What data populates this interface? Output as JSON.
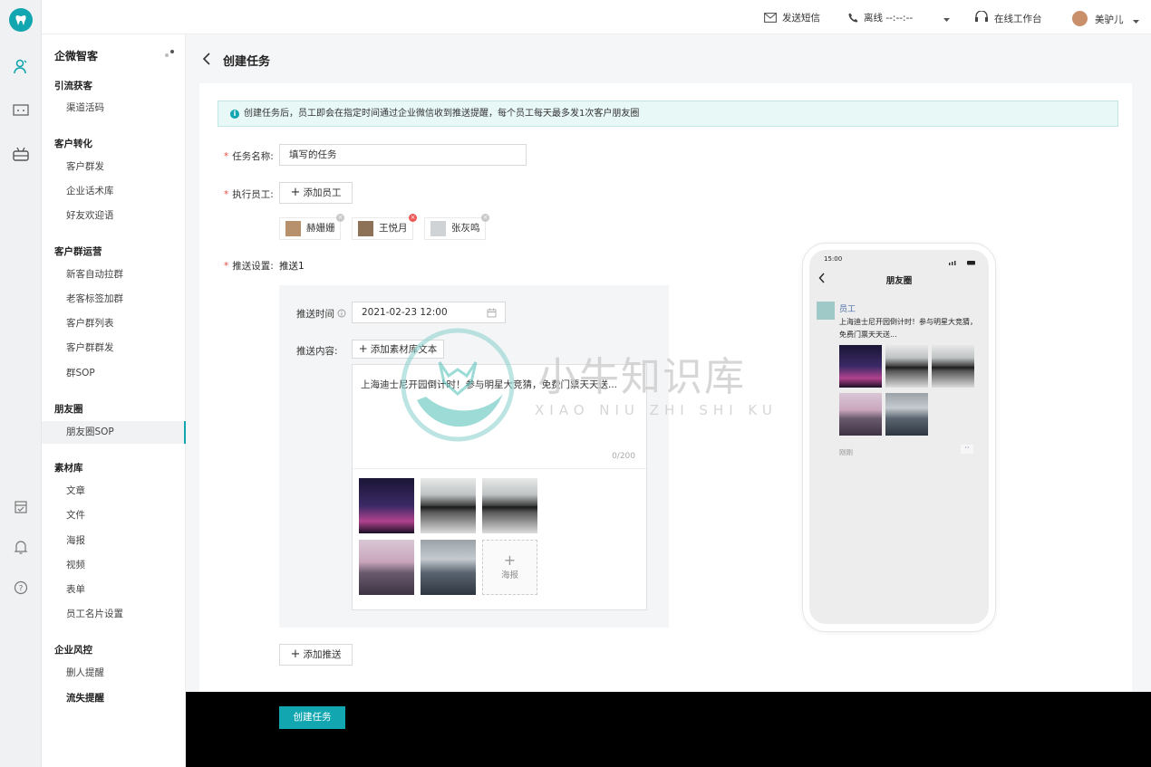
{
  "topbar": {
    "sms_label": "发送短信",
    "phone_status": "离线 --:--:--",
    "workbench_label": "在线工作台",
    "user_name": "美驴儿"
  },
  "menu": {
    "title": "企微智客",
    "groups": [
      {
        "label": "引流获客",
        "items": [
          "渠道活码"
        ]
      },
      {
        "label": "客户转化",
        "items": [
          "客户群发",
          "企业话术库",
          "好友欢迎语"
        ]
      },
      {
        "label": "客户群运营",
        "items": [
          "新客自动拉群",
          "老客标签加群",
          "客户群列表",
          "客户群群发",
          "群SOP"
        ]
      },
      {
        "label": "朋友圈",
        "items": [
          "朋友圈SOP"
        ]
      },
      {
        "label": "素材库",
        "items": [
          "文章",
          "文件",
          "海报",
          "视频",
          "表单",
          "员工名片设置"
        ]
      },
      {
        "label": "企业风控",
        "items": [
          "删人提醒",
          "流失提醒"
        ]
      }
    ]
  },
  "page": {
    "title": "创建任务",
    "notice": "创建任务后，员工即会在指定时间通过企业微信收到推送提醒，每个员工每天最多发1次客户朋友圈"
  },
  "form": {
    "task_name_label": "任务名称:",
    "task_name_placeholder": "填写的任务",
    "staff_label": "执行员工:",
    "add_staff_button": "添加员工",
    "staff": [
      "赫姗姗",
      "王悦月",
      "张灰鸣"
    ],
    "push_label": "推送设置:",
    "push_tab": "推送1",
    "push_time_label": "推送时间",
    "push_time_value": "2021-02-23 12:00",
    "push_content_label": "推送内容:",
    "add_material_button": "添加素材库文本",
    "content_text": "上海迪士尼开园倒计时！参与明星大竞猜，免费门票天天送...",
    "char_count": "0/200",
    "add_poster_label": "海报",
    "add_push_button": "添加推送",
    "submit_button": "创建任务"
  },
  "preview": {
    "time": "15:00",
    "title": "朋友圈",
    "poster_name": "员工",
    "post_text_line1": "上海迪士尼开园倒计时！参与明星大竞猜，",
    "post_text_line2": "免费门票天天送...",
    "post_time": "刚刚",
    "more": "··"
  },
  "watermark": {
    "cn": "小牛知识库",
    "en": "XIAO NIU ZHI SHI KU"
  },
  "colors": {
    "accent": "#12a6b0",
    "required": "#e74c3c",
    "notice_bg": "#e8f8f7"
  }
}
